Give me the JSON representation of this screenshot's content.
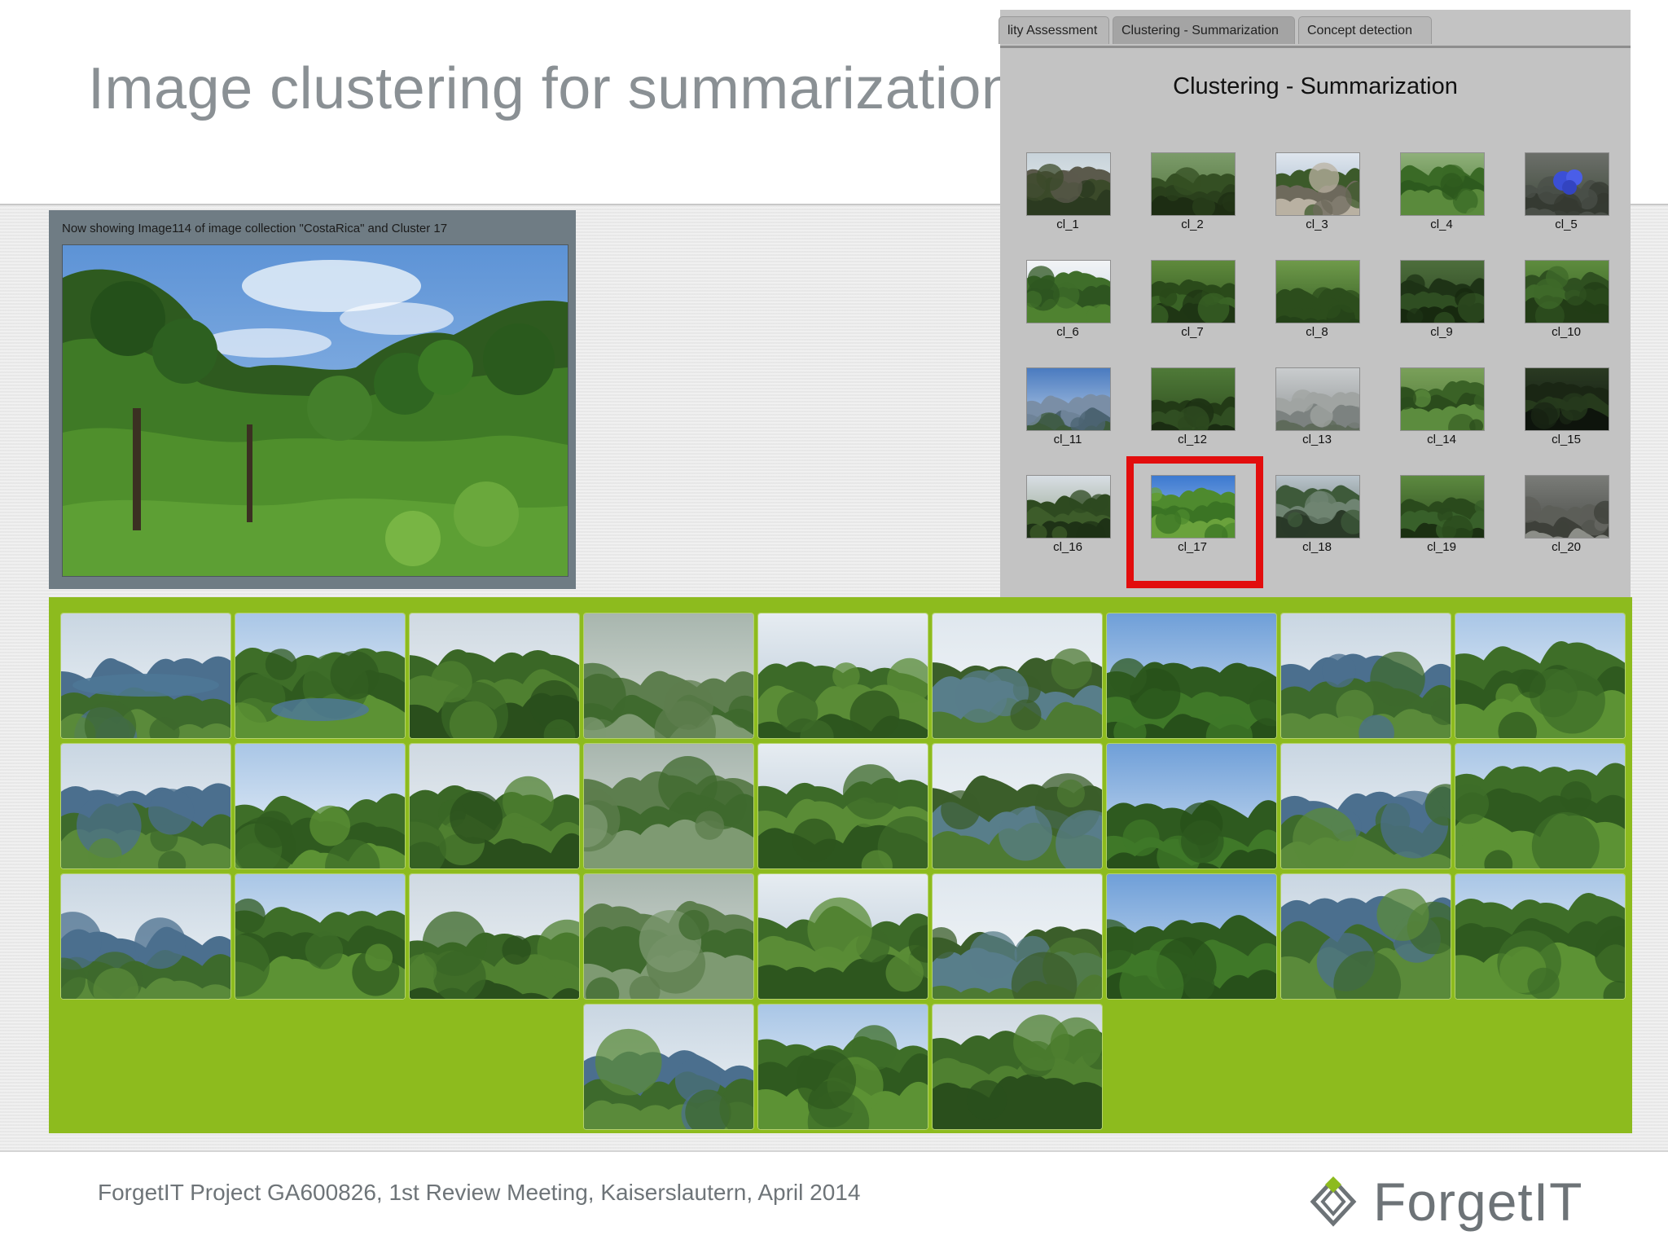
{
  "slide": {
    "title": "Image clustering for summarization",
    "footer": "ForgetIT Project GA600826, 1st Review Meeting, Kaiserslautern, April 2014",
    "logo_text": "ForgetIT"
  },
  "viewer": {
    "caption": "Now showing Image114 of image collection \"CostaRica\" and Cluster 17"
  },
  "cluster_panel": {
    "tabs": [
      "lity Assessment",
      "Clustering - Summarization",
      "Concept detection"
    ],
    "active_tab": "Clustering - Summarization",
    "title": "Clustering - Summarization",
    "clusters": [
      "cl_1",
      "cl_2",
      "cl_3",
      "cl_4",
      "cl_5",
      "cl_6",
      "cl_7",
      "cl_8",
      "cl_9",
      "cl_10",
      "cl_11",
      "cl_12",
      "cl_13",
      "cl_14",
      "cl_15",
      "cl_16",
      "cl_17",
      "cl_18",
      "cl_19",
      "cl_20"
    ],
    "selected_cluster": "cl_17"
  },
  "colors": {
    "gallery_background": "#8dbb1e",
    "selection_frame": "#e20d0d",
    "panel_background": "#c3c3c3",
    "title_text": "#8a9094"
  },
  "gallery": {
    "image_count": 30
  }
}
